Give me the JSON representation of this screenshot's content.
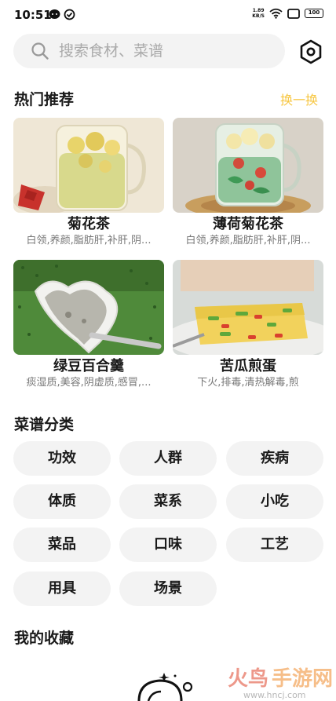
{
  "status_bar": {
    "time": "10:51",
    "net_speed_value": "1.89",
    "net_speed_unit": "KB/S",
    "battery": "100"
  },
  "search": {
    "placeholder": "搜索食材、菜谱"
  },
  "recommend": {
    "title": "热门推荐",
    "refresh_label": "换一换",
    "cards": [
      {
        "title": "菊花茶",
        "subtitle": "白领,养颜,脂肪肝,补肝,阴...",
        "image": "chrysanthemum-tea-photo"
      },
      {
        "title": "薄荷菊花茶",
        "subtitle": "白领,养颜,脂肪肝,补肝,阴...",
        "image": "mint-chrysanthemum-tea-photo"
      },
      {
        "title": "绿豆百合羹",
        "subtitle": "痰湿质,美容,阴虚质,感冒,...",
        "image": "mung-bean-lily-soup-photo"
      },
      {
        "title": "苦瓜煎蛋",
        "subtitle": "下火,排毒,清热解毒,煎",
        "image": "bitter-melon-omelette-photo"
      }
    ]
  },
  "categories": {
    "title": "菜谱分类",
    "items": [
      "功效",
      "人群",
      "疾病",
      "体质",
      "菜系",
      "小吃",
      "菜品",
      "口味",
      "工艺",
      "用具",
      "场景"
    ]
  },
  "favorites": {
    "title": "我的收藏"
  },
  "colors": {
    "accent": "#f7c640",
    "chip_bg": "#f3f3f3"
  }
}
